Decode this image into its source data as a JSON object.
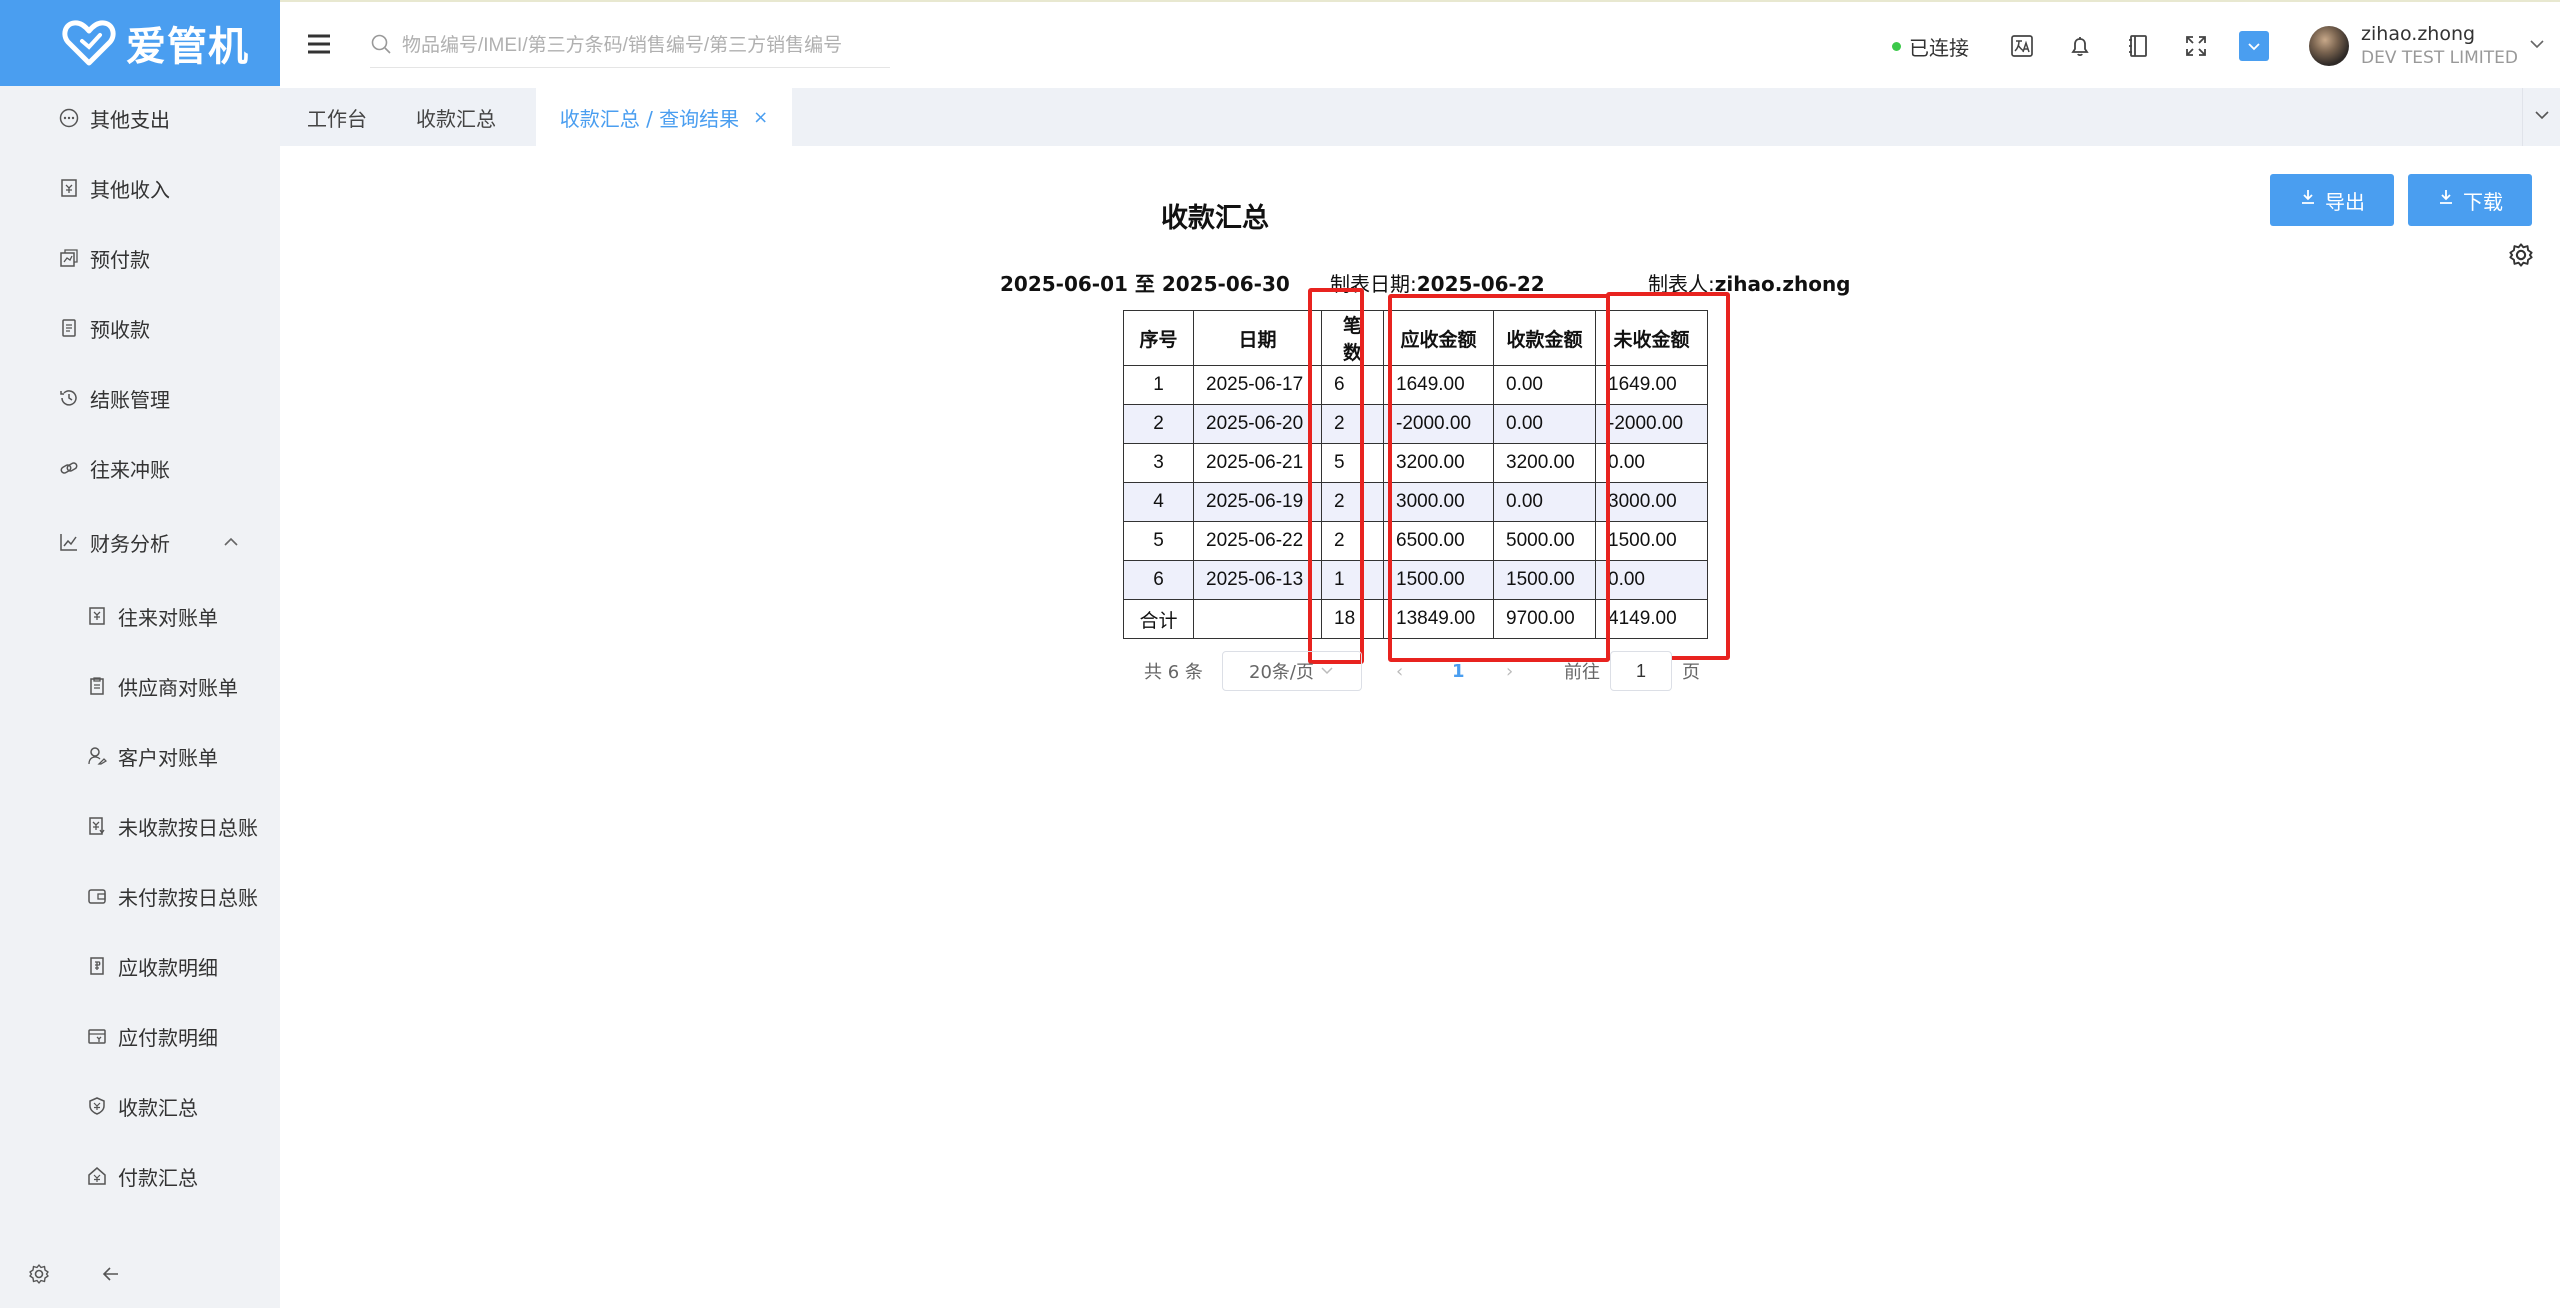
{
  "brand": {
    "name": "爱管机",
    "color": "#4a9ef0"
  },
  "sidebar": {
    "items": [
      {
        "label": "其他支出",
        "icon": "ellipsis-circle-icon",
        "level": 1
      },
      {
        "label": "其他收入",
        "icon": "receipt-icon",
        "level": 1
      },
      {
        "label": "预付款",
        "icon": "chart-card-icon",
        "level": 1
      },
      {
        "label": "预收款",
        "icon": "document-icon",
        "level": 1
      },
      {
        "label": "结账管理",
        "icon": "history-icon",
        "level": 1
      },
      {
        "label": "往来冲账",
        "icon": "link-icon",
        "level": 1
      },
      {
        "label": "财务分析",
        "icon": "analytics-icon",
        "level": 1,
        "expanded": true
      },
      {
        "label": "往来对账单",
        "icon": "yen-document-icon",
        "level": 2
      },
      {
        "label": "供应商对账单",
        "icon": "clipboard-icon",
        "level": 2
      },
      {
        "label": "客户对账单",
        "icon": "user-edit-icon",
        "level": 2
      },
      {
        "label": "未收款按日总账",
        "icon": "yen-document-icon",
        "level": 2
      },
      {
        "label": "未付款按日总账",
        "icon": "wallet-icon",
        "level": 2
      },
      {
        "label": "应收款明细",
        "icon": "money-document-icon",
        "level": 2
      },
      {
        "label": "应付款明细",
        "icon": "card-icon",
        "level": 2
      },
      {
        "label": "收款汇总",
        "icon": "shield-yen-icon",
        "level": 2
      },
      {
        "label": "付款汇总",
        "icon": "house-yen-icon",
        "level": 2
      }
    ]
  },
  "header": {
    "search_placeholder": "物品编号/IMEI/第三方条码/销售编号/第三方销售编号",
    "status": "已连接",
    "status_color": "#3cc94a",
    "user_name": "zihao.zhong",
    "company": "DEV TEST LIMITED"
  },
  "tabs": [
    {
      "label": "工作台"
    },
    {
      "label": "收款汇总"
    },
    {
      "label": "收款汇总 / 查询结果",
      "active": true
    }
  ],
  "toolbar": {
    "export_label": "导出",
    "download_label": "下载"
  },
  "report": {
    "title": "收款汇总",
    "period": "2025-06-01 至 2025-06-30",
    "made_date_label": "制表日期:",
    "made_date": "2025-06-22",
    "maker_label": "制表人:",
    "maker": "zihao.zhong",
    "columns": [
      "序号",
      "日期",
      "笔数",
      "应收金额",
      "收款金额",
      "未收金额"
    ],
    "rows": [
      [
        "1",
        "2025-06-17",
        "6",
        "1649.00",
        "0.00",
        "1649.00"
      ],
      [
        "2",
        "2025-06-20",
        "2",
        "-2000.00",
        "0.00",
        "-2000.00"
      ],
      [
        "3",
        "2025-06-21",
        "5",
        "3200.00",
        "3200.00",
        "0.00"
      ],
      [
        "4",
        "2025-06-19",
        "2",
        "3000.00",
        "0.00",
        "3000.00"
      ],
      [
        "5",
        "2025-06-22",
        "2",
        "6500.00",
        "5000.00",
        "1500.00"
      ],
      [
        "6",
        "2025-06-13",
        "1",
        "1500.00",
        "1500.00",
        "0.00"
      ]
    ],
    "total": [
      "合计",
      "",
      "18",
      "13849.00",
      "9700.00",
      "4149.00"
    ],
    "highlight_color": "#e8231f"
  },
  "pagination": {
    "total_text": "共 6 条",
    "page_size": "20条/页",
    "current_page": "1",
    "goto_label": "前往",
    "goto_value": "1",
    "page_suffix": "页"
  }
}
